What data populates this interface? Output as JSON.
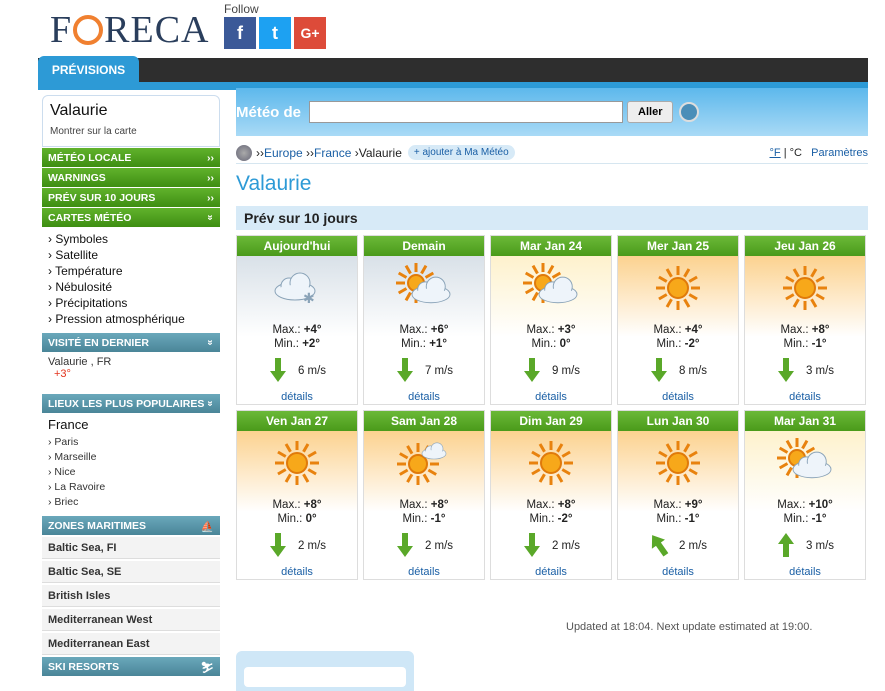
{
  "header": {
    "logo_pre": "F",
    "logo_post": "RECA",
    "follow": "Follow",
    "fb": "f",
    "tw": "t",
    "gp": "G+"
  },
  "nav": {
    "tab": "PRÉVISIONS"
  },
  "sidebar": {
    "title": "Valaurie",
    "map_link": "Montrer sur la carte",
    "meteo_locale": "MÉTÉO LOCALE",
    "warnings": "WARNINGS",
    "prev10": "PRÉV SUR 10 JOURS",
    "cartes": "CARTES MÉTÉO",
    "cartes_items": [
      "Symboles",
      "Satellite",
      "Température",
      "Nébulosité",
      "Précipitations",
      "Pression atmosphérique"
    ],
    "visited_title": "VISITÉ EN DERNIER",
    "visited_name": "Valaurie , FR",
    "visited_temp": "+3°",
    "popular_title": "LIEUX LES PLUS POPULAIRES",
    "popular_country": "France",
    "popular_items": [
      "Paris",
      "Marseille",
      "Nice",
      "La Ravoire",
      "Briec"
    ],
    "maritime_title": "ZONES MARITIMES",
    "maritime_items": [
      "Baltic Sea, FI",
      "Baltic Sea, SE",
      "British Isles",
      "Mediterranean West",
      "Mediterranean East"
    ],
    "ski_title": "SKI RESORTS",
    "chev": "››",
    "chev_down": "»"
  },
  "search": {
    "label": "Météo de",
    "value": "",
    "button": "Aller"
  },
  "breadcrumb": {
    "europe": "Europe",
    "france": "France",
    "city": "Valaurie",
    "add": "+ ajouter à Ma Météo",
    "f": "°F",
    "sep": "|",
    "c": "°C",
    "params": "Paramètres"
  },
  "page": {
    "city": "Valaurie",
    "forecast_title": "Prév sur 10 jours",
    "updated": "Updated at 18:04. Next update estimated at 19:00."
  },
  "labels": {
    "max": "Max.:",
    "min": "Min.:",
    "details": "détails"
  },
  "days": [
    {
      "name": "Aujourd'hui",
      "max": "+4°",
      "min": "+2°",
      "wind": "6 m/s",
      "icon": "cloud-snow-icon",
      "bg": "grey",
      "dir": "down"
    },
    {
      "name": "Demain",
      "max": "+6°",
      "min": "+1°",
      "wind": "7 m/s",
      "icon": "partly-cloudy-icon",
      "bg": "grey",
      "dir": "down"
    },
    {
      "name": "Mar Jan 24",
      "max": "+3°",
      "min": "0°",
      "wind": "9 m/s",
      "icon": "partly-cloudy-icon",
      "bg": "pale",
      "dir": "down"
    },
    {
      "name": "Mer Jan 25",
      "max": "+4°",
      "min": "-2°",
      "wind": "8 m/s",
      "icon": "sun-icon",
      "bg": "warm",
      "dir": "down"
    },
    {
      "name": "Jeu Jan 26",
      "max": "+8°",
      "min": "-1°",
      "wind": "3 m/s",
      "icon": "sun-icon",
      "bg": "warm",
      "dir": "down"
    },
    {
      "name": "Ven Jan 27",
      "max": "+8°",
      "min": "0°",
      "wind": "2 m/s",
      "icon": "sun-icon",
      "bg": "warm",
      "dir": "down"
    },
    {
      "name": "Sam Jan 28",
      "max": "+8°",
      "min": "-1°",
      "wind": "2 m/s",
      "icon": "sun-cloud-icon",
      "bg": "warm",
      "dir": "down"
    },
    {
      "name": "Dim Jan 29",
      "max": "+8°",
      "min": "-2°",
      "wind": "2 m/s",
      "icon": "sun-icon",
      "bg": "warm",
      "dir": "down"
    },
    {
      "name": "Lun Jan 30",
      "max": "+9°",
      "min": "-1°",
      "wind": "2 m/s",
      "icon": "sun-icon",
      "bg": "warm",
      "dir": "upleft"
    },
    {
      "name": "Mar Jan 31",
      "max": "+10°",
      "min": "-1°",
      "wind": "3 m/s",
      "icon": "partly-cloudy-icon",
      "bg": "pale",
      "dir": "up"
    }
  ]
}
